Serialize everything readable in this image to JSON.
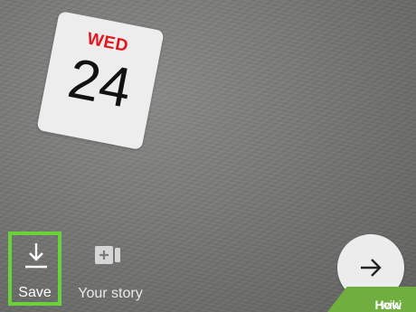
{
  "sticker": {
    "day": "WED",
    "date": "24"
  },
  "bottom_bar": {
    "save_label": "Save",
    "story_label": "Your story",
    "next_icon": "arrow-right-icon"
  },
  "watermark": {
    "brand_prefix": "wiki",
    "brand_suffix": "How"
  },
  "colors": {
    "highlight": "#6bd13a",
    "day_red": "#e3161c",
    "watermark_bg": "#6fae3f"
  }
}
